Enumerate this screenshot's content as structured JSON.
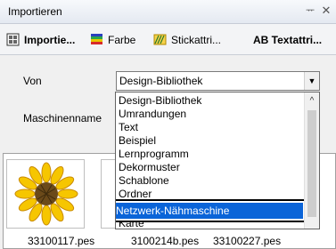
{
  "panel": {
    "title": "Importieren",
    "pin_glyph": "ᅲ",
    "close_glyph": "✕"
  },
  "tabs": [
    {
      "label": "Importie...",
      "icon": "import-icon"
    },
    {
      "label": "Farbe",
      "icon": "color-icon"
    },
    {
      "label": "Stickattri...",
      "icon": "stitch-attributes-icon"
    },
    {
      "label": "AB Textattri...",
      "icon": "text-attributes-icon"
    }
  ],
  "form": {
    "von_label": "Von",
    "maschinenname_label": "Maschinenname",
    "von_value": "Design-Bibliothek",
    "dropdown_arrow": "▼"
  },
  "dropdown": {
    "options": [
      "Design-Bibliothek",
      "Umrandungen",
      "Text",
      "Beispiel",
      "Lernprogramm",
      "Dekormuster",
      "Schablone",
      "Ordner",
      "Karte"
    ],
    "selected": "Netzwerk-Nähmaschine",
    "scroll_up_glyph": "^"
  },
  "gallery": {
    "files": [
      "33100117.pes",
      "3100214b.pes",
      "33100227.pes"
    ]
  },
  "colors": {
    "selection": "#0a64d8",
    "sunflower_petals": "#f6c600",
    "sunflower_center": "#6b4a1a"
  }
}
